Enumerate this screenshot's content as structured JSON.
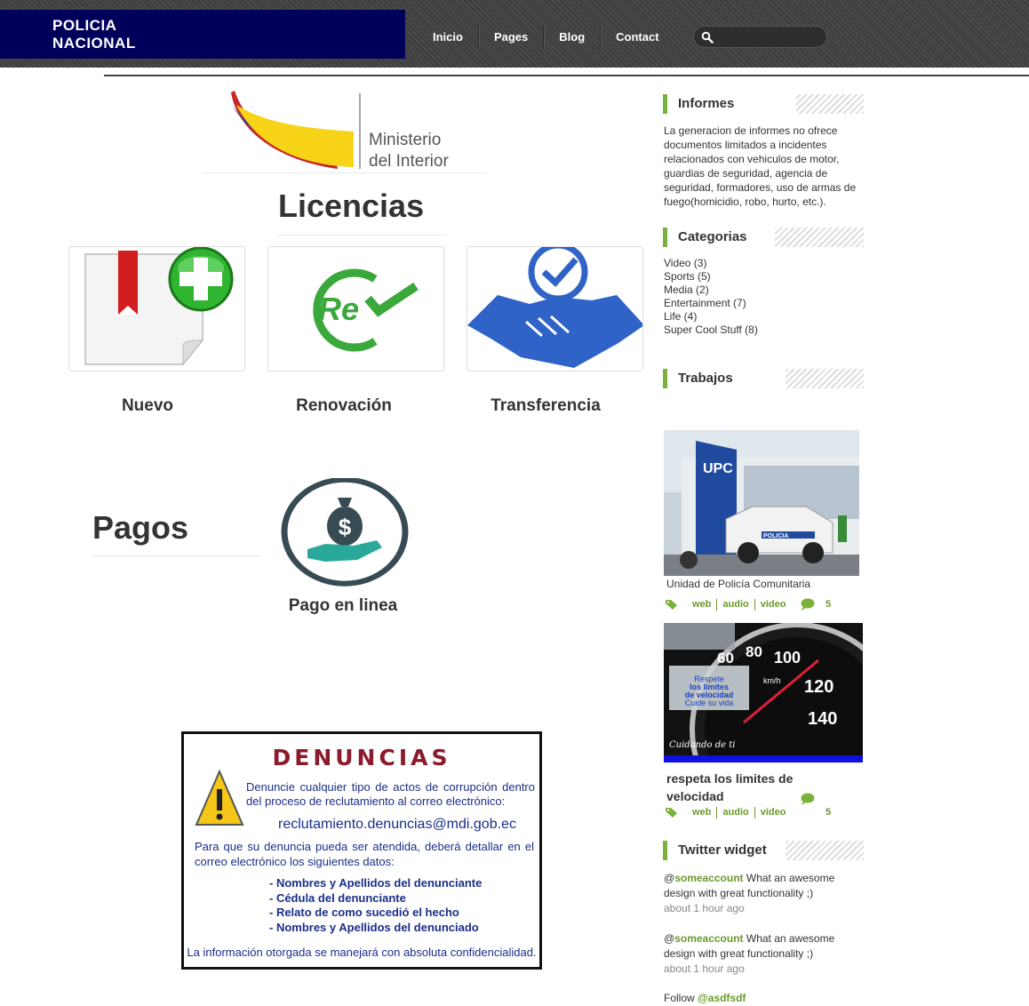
{
  "header": {
    "brand_line1": "POLICIA",
    "brand_line2": "NACIONAL",
    "nav": [
      "Inicio",
      "Pages",
      "Blog",
      "Contact"
    ],
    "search_placeholder": ""
  },
  "logo": {
    "line1": "Ministerio",
    "line2": "del Interior"
  },
  "licencias": {
    "title": "Licencias",
    "items": [
      {
        "label": "Nuevo",
        "icon": "add-document-icon"
      },
      {
        "label": "Renovación",
        "icon": "renew-icon"
      },
      {
        "label": "Transferencia",
        "icon": "handshake-icon"
      }
    ]
  },
  "pagos": {
    "title": "Pagos",
    "item_label": "Pago en linea",
    "icon": "money-bag-hand-icon"
  },
  "denuncias": {
    "title": "DENUNCIAS",
    "paragraph1": "Denuncie cualquier tipo de actos de corrupción dentro del proceso de reclutamiento al correo electrónico:",
    "email": "reclutamiento.denuncias@mdi.gob.ec",
    "paragraph2": "Para que su denuncia pueda ser atendida, deberá detallar en el correo electrónico los siguientes datos:",
    "items": [
      "- Nombres y Apellidos del denunciante",
      "- Cédula del denunciante",
      "- Relato de como sucedió el hecho",
      "- Nombres y Apellidos del denunciado"
    ],
    "footer": "La información otorgada se manejará con absoluta confidencialidad."
  },
  "sidebar": {
    "informes": {
      "title": "Informes",
      "text": "La generacion de informes no ofrece documentos limitados a incidentes relacionados con vehiculos de motor, guardias de seguridad, agencia de seguridad, formadores, uso de armas de fuego(homicidio, robo, hurto, etc.)."
    },
    "categorias": {
      "title": "Categorias",
      "items": [
        "Video (3)",
        "Sports (5)",
        "Media (2)",
        "Entertainment (7)",
        "Life (4)",
        "Super Cool Stuff (8)"
      ]
    },
    "trabajos": {
      "title": "Trabajos",
      "works": [
        {
          "title": "Unidad de Policía Comunitaria",
          "image_sign": "UPC",
          "image_car_text": "POLICIA",
          "tags": [
            "web",
            "audio",
            "video"
          ],
          "comments": "5"
        },
        {
          "title": "respeta los limites de velocidad",
          "image_text1": "Respete",
          "image_text2": "los límites",
          "image_text3": "de velocidad",
          "image_text4": "Cuide su vida",
          "image_caption": "Cuidando de ti",
          "image_unit": "km/h",
          "image_ticks": [
            "60",
            "80",
            "100",
            "120",
            "140"
          ],
          "tags": [
            "web",
            "audio",
            "video"
          ],
          "comments": "5"
        }
      ]
    },
    "twitter": {
      "title": "Twitter widget",
      "tweets": [
        {
          "at": "@",
          "handle": "someaccount",
          "text": " What an awesome design with great functionality ;)",
          "time": "about 1 hour ago"
        },
        {
          "at": "@",
          "handle": "someaccount",
          "text": " What an awesome design with great functionality ;)",
          "time": "about 1 hour ago"
        }
      ],
      "follow_prefix": "Follow ",
      "follow_handle": "@asdfsdf"
    }
  },
  "colors": {
    "brand_bg": "#00005a",
    "accent_green": "#7ab13b",
    "tile_icon_blue": "#2f63c8",
    "tile_icon_green": "#3aa83a",
    "denuncias_blue": "#1a2e8a",
    "denuncias_red": "#8a1a2c"
  }
}
